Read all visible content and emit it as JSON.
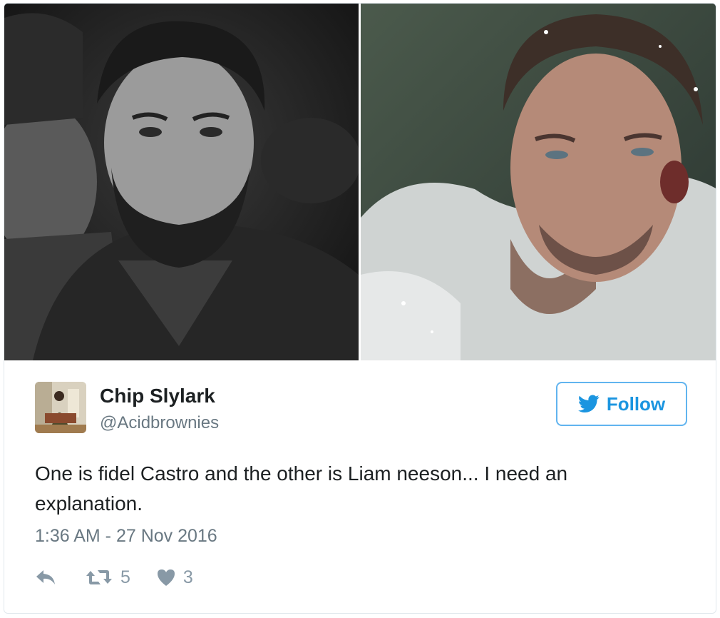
{
  "media": {
    "image_left_icon": "photo-black-and-white-portrait",
    "image_right_icon": "photo-color-portrait-snow"
  },
  "author": {
    "display_name": "Chip Slylark",
    "handle": "@Acidbrownies",
    "avatar_icon": "avatar-photo"
  },
  "follow_button": {
    "label": "Follow",
    "icon": "twitter-bird-icon",
    "color": "#1b95e0",
    "border_color": "#61b4ef"
  },
  "tweet": {
    "text": "One is fidel Castro and the other is Liam neeson... I need an explanation.",
    "timestamp": "1:36 AM - 27 Nov 2016"
  },
  "actions": {
    "reply_icon": "reply-icon",
    "retweet_icon": "retweet-icon",
    "retweet_count": "5",
    "like_icon": "heart-icon",
    "like_count": "3"
  },
  "colors": {
    "text_primary": "#1c2022",
    "text_secondary": "#697882",
    "action_gray": "#8899a6",
    "border": "#e1e8ed"
  }
}
